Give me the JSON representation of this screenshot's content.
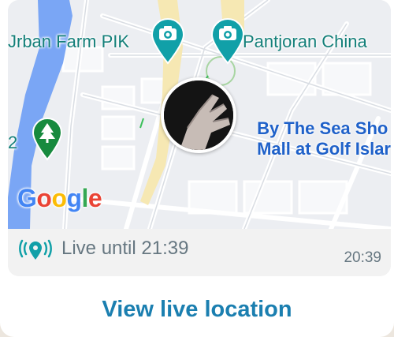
{
  "map": {
    "places": [
      {
        "label": "Jrban Farm PIK"
      },
      {
        "label": "Pantjoran China"
      },
      {
        "label": "By The Sea Sho\nMall at Golf Islar"
      },
      {
        "label": "2"
      }
    ],
    "attribution": {
      "letters": [
        "G",
        "o",
        "o",
        "g",
        "l",
        "e"
      ]
    }
  },
  "location": {
    "status_label": "Live until 21:39",
    "message_time": "20:39"
  },
  "actions": {
    "view_live_location": "View live location"
  },
  "colors": {
    "accent": "#1b7fb0",
    "pin_teal": "#11a0a8",
    "park_green": "#178a3e",
    "water": "#7aa6f5"
  },
  "icons": [
    "camera-pin-icon",
    "tree-pin-icon",
    "live-location-icon",
    "user-avatar"
  ]
}
